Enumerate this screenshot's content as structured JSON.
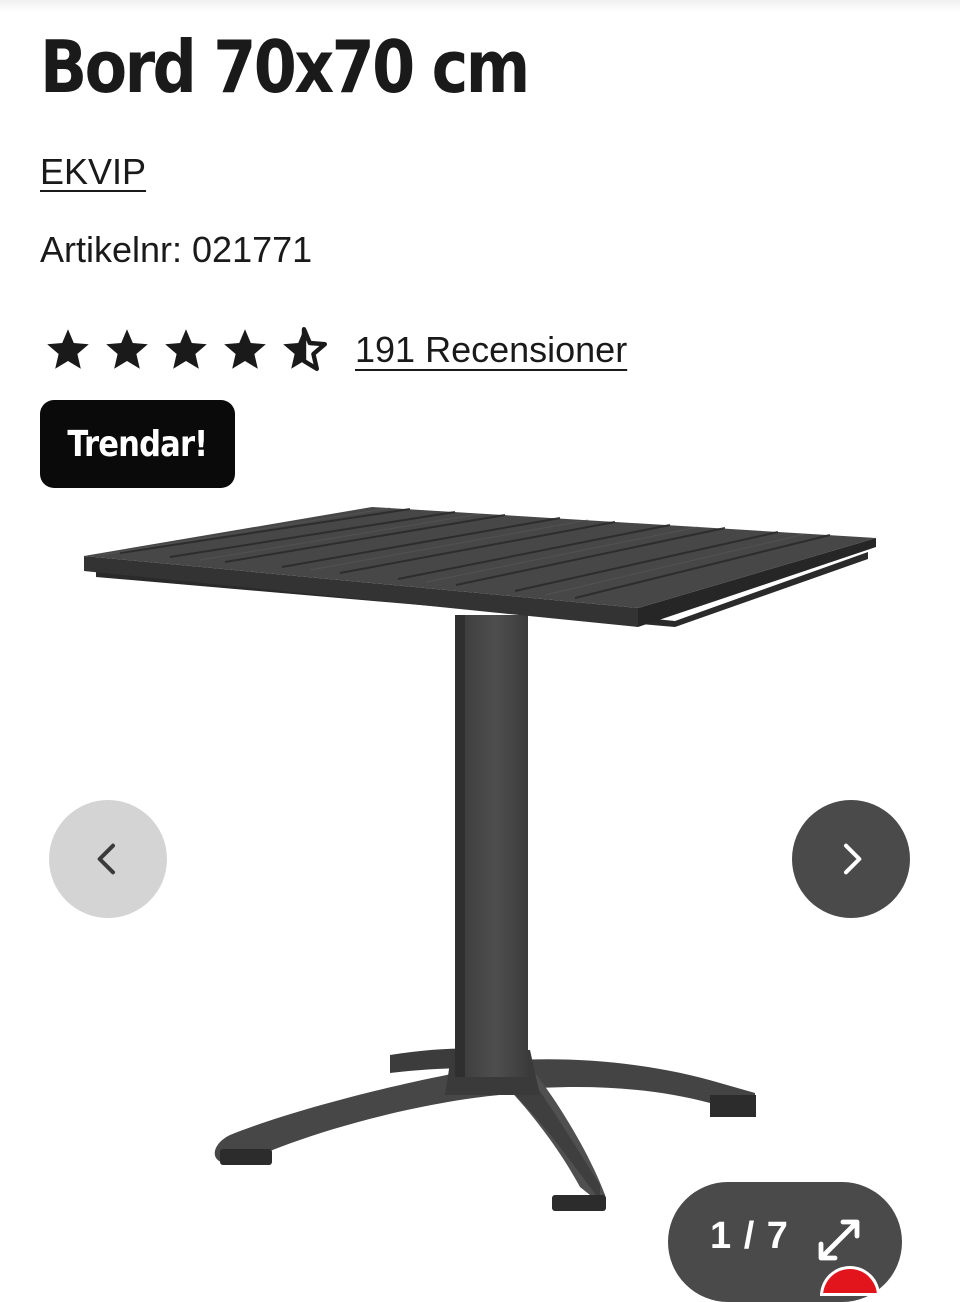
{
  "product": {
    "title": "Bord 70x70 cm",
    "brand": "EKVIP",
    "article_number": "Artikelnr: 021771",
    "rating": {
      "stars": 4.5,
      "max_stars": 5,
      "reviews_label": "191 Recensioner"
    },
    "badge": "Trendar!"
  },
  "gallery": {
    "prev_icon": "chevron-left-icon",
    "next_icon": "chevron-right-icon",
    "counter": "1 / 7",
    "expand_icon": "expand-icon",
    "image_subject": "black-square-patio-table"
  },
  "colors": {
    "text": "#1a1a1a",
    "badge_bg": "#0a0a0a",
    "nav_prev_bg": "#d4d4d4",
    "nav_next_bg": "#4a4a4a",
    "accent_red": "#e2141c"
  }
}
